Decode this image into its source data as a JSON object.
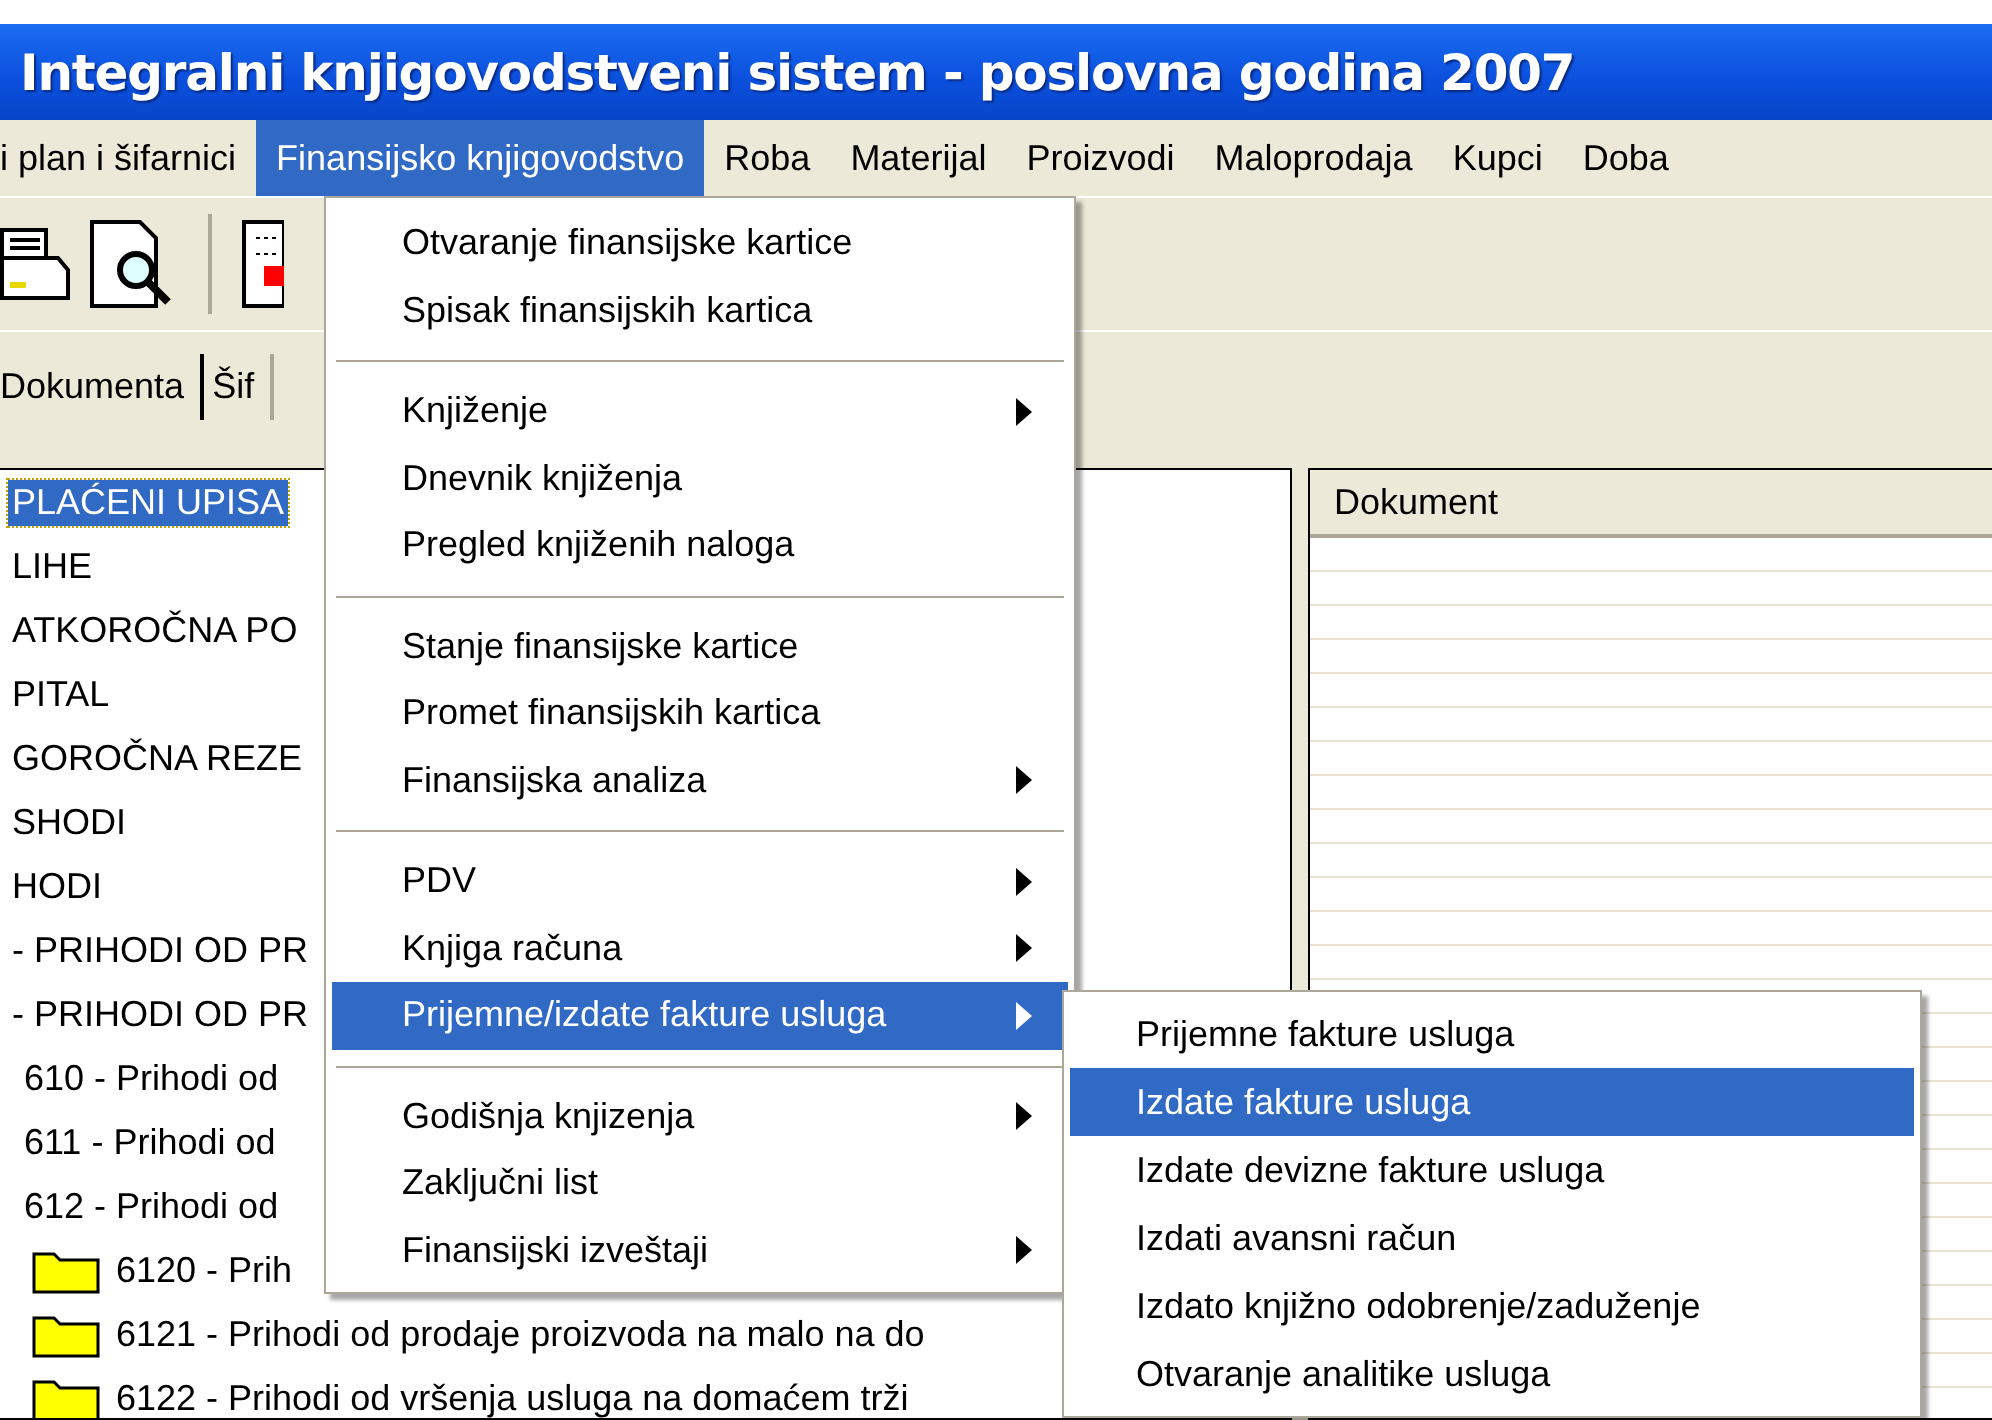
{
  "window": {
    "title": "Integralni knjigovodstveni sistem - poslovna godina 2007"
  },
  "menubar": [
    {
      "label": "i plan i šifarnici",
      "selected": false
    },
    {
      "label": "Finansijsko knjigovodstvo",
      "selected": true
    },
    {
      "label": "Roba",
      "selected": false
    },
    {
      "label": "Materijal",
      "selected": false
    },
    {
      "label": "Proizvodi",
      "selected": false
    },
    {
      "label": "Maloprodaja",
      "selected": false
    },
    {
      "label": "Kupci",
      "selected": false
    },
    {
      "label": "Doba",
      "selected": false
    }
  ],
  "tabs": [
    {
      "label": "Dokumenta",
      "selected": true
    },
    {
      "label": "Šif",
      "selected": false
    }
  ],
  "tree": [
    {
      "label": "PLAĆENI UPISA",
      "selected": true
    },
    {
      "label": "LIHE",
      "selected": false
    },
    {
      "label": "ATKOROČNA PO",
      "selected": false
    },
    {
      "label": "PITAL",
      "selected": false
    },
    {
      "label": "GOROČNA REZE",
      "selected": false
    },
    {
      "label": "SHODI",
      "selected": false
    },
    {
      "label": "HODI",
      "selected": false
    },
    {
      "label": "- PRIHODI OD PR",
      "selected": false
    },
    {
      "label": "- PRIHODI OD PR",
      "selected": false,
      "children": [
        {
          "label": "610 - Prihodi od",
          "selected": false
        },
        {
          "label": "611 - Prihodi od",
          "selected": false
        },
        {
          "label": "612 - Prihodi od",
          "selected": false,
          "children": [
            {
              "label": "6120 - Prih",
              "selected": false
            },
            {
              "label": "6121 - Prihodi od prodaje proizvoda na malo na do",
              "selected": false
            },
            {
              "label": "6122 - Prihodi od vršenja usluga na domaćem trži",
              "selected": false
            }
          ]
        }
      ]
    }
  ],
  "document_list": {
    "columns": [
      "Dokument"
    ]
  },
  "menu": [
    {
      "kind": "item",
      "label": "Otvaranje finansijske kartice",
      "submenu": false,
      "selected": false
    },
    {
      "kind": "item",
      "label": "Spisak finansijskih kartica",
      "submenu": false,
      "selected": false
    },
    {
      "kind": "separator"
    },
    {
      "kind": "item",
      "label": "Knjiženje",
      "submenu": true,
      "selected": false
    },
    {
      "kind": "item",
      "label": "Dnevnik knjiženja",
      "submenu": false,
      "selected": false
    },
    {
      "kind": "item",
      "label": "Pregled knjiženih naloga",
      "submenu": false,
      "selected": false
    },
    {
      "kind": "separator"
    },
    {
      "kind": "item",
      "label": "Stanje finansijske kartice",
      "submenu": false,
      "selected": false
    },
    {
      "kind": "item",
      "label": "Promet finansijskih kartica",
      "submenu": false,
      "selected": false
    },
    {
      "kind": "item",
      "label": "Finansijska analiza",
      "submenu": true,
      "selected": false
    },
    {
      "kind": "separator"
    },
    {
      "kind": "item",
      "label": "PDV",
      "submenu": true,
      "selected": false
    },
    {
      "kind": "item",
      "label": "Knjiga računa",
      "submenu": true,
      "selected": false
    },
    {
      "kind": "item",
      "label": "Prijemne/izdate fakture usluga",
      "submenu": true,
      "selected": true
    },
    {
      "kind": "separator"
    },
    {
      "kind": "item",
      "label": "Godišnja knjizenja",
      "submenu": true,
      "selected": false
    },
    {
      "kind": "item",
      "label": "Zaključni list",
      "submenu": false,
      "selected": false
    },
    {
      "kind": "item",
      "label": "Finansijski izveštaji",
      "submenu": true,
      "selected": false
    }
  ],
  "submenu": [
    {
      "label": "Prijemne fakture usluga",
      "selected": false
    },
    {
      "label": "Izdate fakture usluga",
      "selected": true
    },
    {
      "label": "Izdate devizne fakture usluga",
      "selected": false
    },
    {
      "label": "Izdati avansni račun",
      "selected": false
    },
    {
      "label": "Izdato knjižno odobrenje/zaduženje",
      "selected": false
    },
    {
      "label": "Otvaranje analitike usluga",
      "selected": false
    }
  ]
}
